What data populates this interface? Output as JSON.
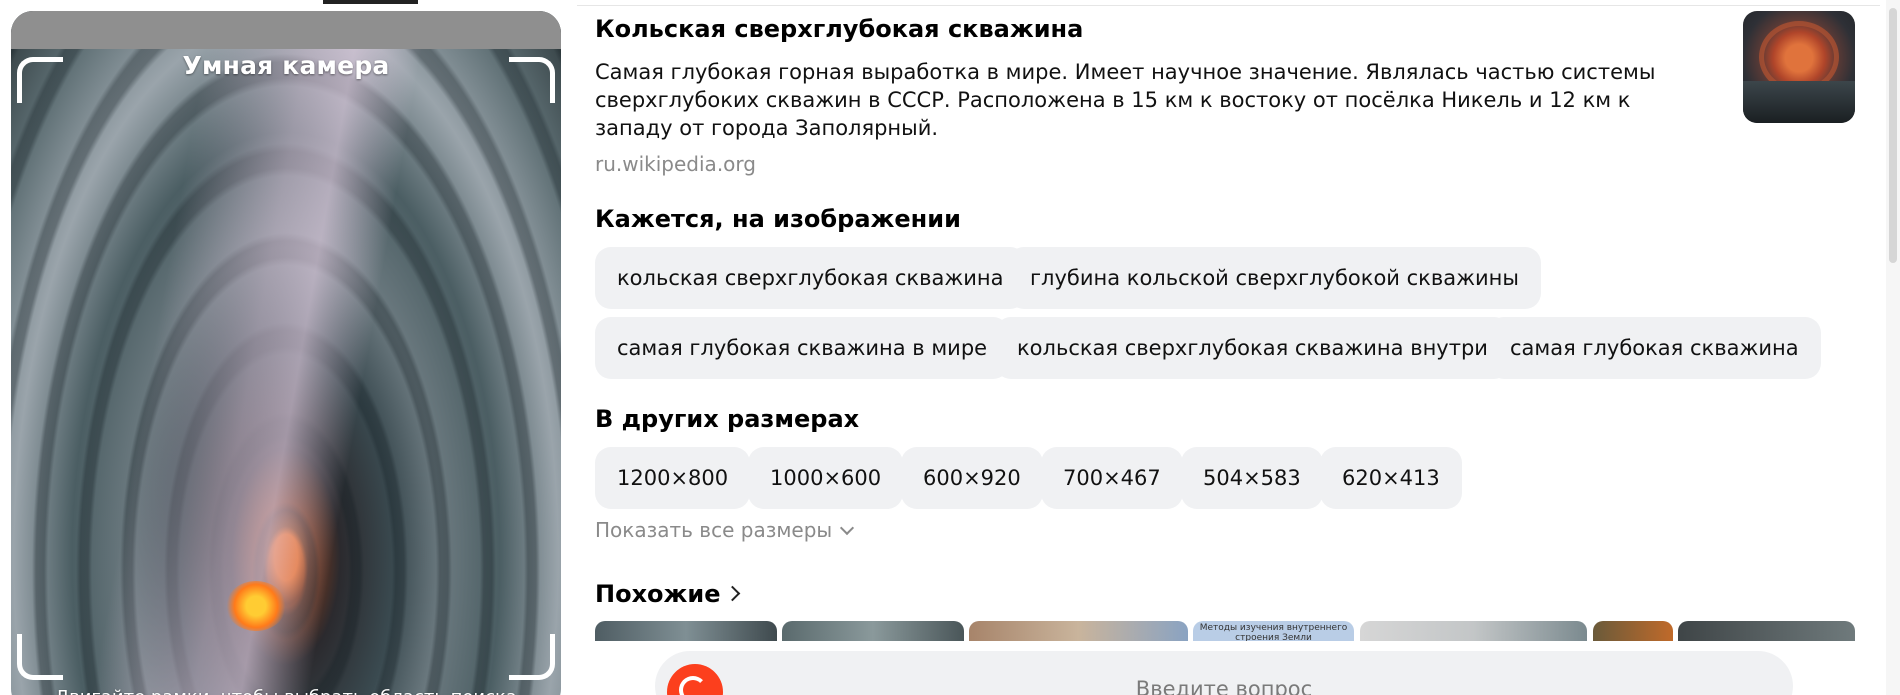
{
  "camera": {
    "title": "Умная камера",
    "hint": "Двигайте рамки, чтобы выбрать область поиска"
  },
  "entity": {
    "title": "Кольская сверхглубокая скважина",
    "description": "Самая глубокая горная выработка в мире. Имеет научное значение. Являлась частью системы сверхглубоких скважин в СССР. Расположена в 15 км к востоку от посёлка Никель и 12 км к западу от города Заполярный.",
    "source": "ru.wikipedia.org"
  },
  "objects": {
    "heading": "Кажется, на изображении",
    "chips": [
      "кольская сверхглубокая скважина",
      "глубина кольской сверхглубокой скважины",
      "самая глубокая скважина в мире",
      "кольская сверхглубокая скважина внутри",
      "самая глубокая скважина"
    ]
  },
  "sizes": {
    "heading": "В других размерах",
    "items": [
      "1200×800",
      "1000×600",
      "600×920",
      "700×467",
      "504×583",
      "620×413"
    ],
    "show_all": "Показать все размеры"
  },
  "similar": {
    "heading": "Похожие",
    "thumb_caption": "Методы изучения внутреннего строения Земли"
  },
  "query": {
    "placeholder": "Введите вопрос"
  },
  "colors": {
    "chip_bg": "#f0f1f3",
    "muted_text": "#8a8a8a",
    "brand_red": "#fc3f1d"
  }
}
